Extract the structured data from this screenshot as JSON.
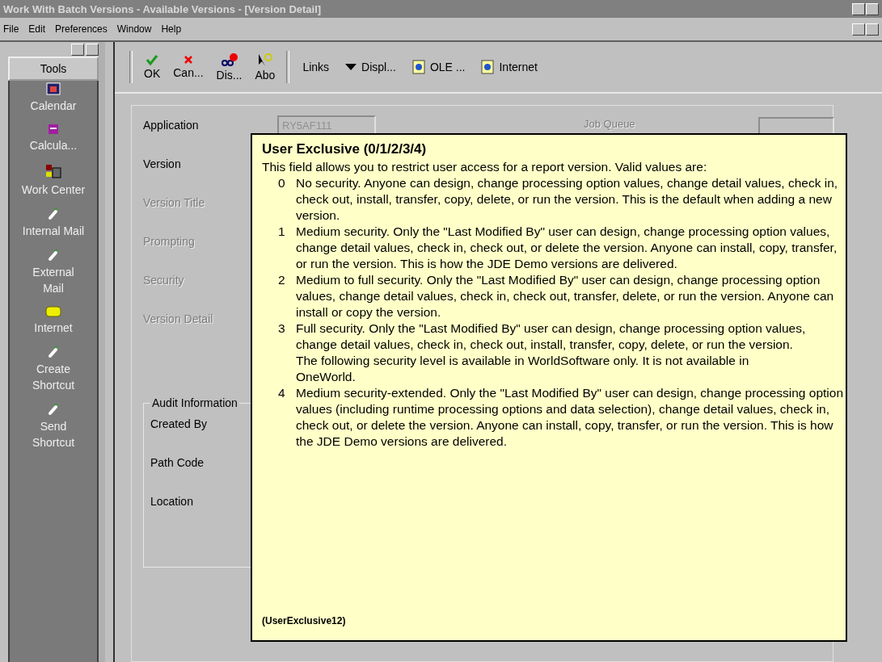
{
  "window": {
    "title": "Work With Batch Versions - Available Versions - [Version Detail]"
  },
  "menu": [
    "File",
    "Edit",
    "Preferences",
    "Window",
    "Help"
  ],
  "sidebar": {
    "header": "Tools",
    "items": [
      {
        "label": "Calendar",
        "kind": "calendar"
      },
      {
        "label": "Calcula...",
        "kind": "calculator"
      },
      {
        "label": "Work Center",
        "kind": "workcenter"
      },
      {
        "label": "Internal Mail",
        "kind": "clip"
      },
      {
        "label": "External Mail",
        "kind": "clip"
      },
      {
        "label": "Internet",
        "kind": "phone"
      },
      {
        "label": "Create Shortcut",
        "kind": "clip"
      },
      {
        "label": "Send Shortcut",
        "kind": "clip"
      }
    ]
  },
  "toolbar": {
    "buttons": [
      {
        "label": "OK",
        "kind": "ok"
      },
      {
        "label": "Can...",
        "kind": "cancel"
      },
      {
        "label": "Dis...",
        "kind": "display"
      },
      {
        "label": "Abo",
        "kind": "about"
      }
    ],
    "links": [
      {
        "label": "Links",
        "kind": "text"
      },
      {
        "label": "Displ...",
        "kind": "dropdown"
      },
      {
        "label": "OLE ...",
        "kind": "doc"
      },
      {
        "label": "Internet",
        "kind": "doc"
      }
    ]
  },
  "form": {
    "fields": [
      {
        "label": "Application",
        "disabled": false,
        "value": "RY5AF111"
      },
      {
        "label": "Version",
        "disabled": false
      },
      {
        "label": "Version Title",
        "disabled": true
      },
      {
        "label": "Prompting",
        "disabled": true
      },
      {
        "label": "Security",
        "disabled": true
      },
      {
        "label": "Version Detail",
        "disabled": true
      }
    ],
    "job_queue": {
      "label": "Job Queue"
    },
    "audit": {
      "title": "Audit Information",
      "fields": [
        "Created By",
        "Path Code",
        "Location"
      ]
    }
  },
  "tooltip": {
    "title": "User Exclusive (0/1/2/3/4)",
    "intro": "This field allows you to restrict user access for a report version. Valid values are:",
    "items": [
      {
        "kind": "option",
        "number": "0",
        "text": "No security. Anyone can design, change processing option values, change detail values, check in, check out, install, transfer, copy, delete, or run the version. This is the default when adding a new version."
      },
      {
        "kind": "option",
        "number": "1",
        "text": "Medium security. Only the \"Last Modified By\" user can design, change processing option values, change detail values, check in, check out, or delete the version. Anyone can install, copy, transfer, or run the version. This is how the JDE Demo versions are delivered."
      },
      {
        "kind": "option",
        "number": "2",
        "text": "Medium to full security. Only the \"Last Modified By\" user can design, change processing option values, change detail values, check in, check out, transfer, delete, or run the version. Anyone can install or copy the version."
      },
      {
        "kind": "option",
        "number": "3",
        "text": "Full security. Only the \"Last Modified By\" user can design, change processing option values, change detail values, check in, check out, install, transfer, copy, delete, or run the version."
      },
      {
        "kind": "note",
        "text": "The following security level is available in WorldSoftware only. It is not available in OneWorld."
      },
      {
        "kind": "option",
        "number": "4",
        "text": "Medium security-extended. Only the \"Last Modified By\" user can design, change processing option values (including runtime processing options and data selection), change detail values, check in, check out, or delete the version. Anyone can install, copy, transfer, or run the version. This is how the JDE Demo versions are delivered."
      }
    ],
    "footer": "(UserExclusive12)"
  }
}
